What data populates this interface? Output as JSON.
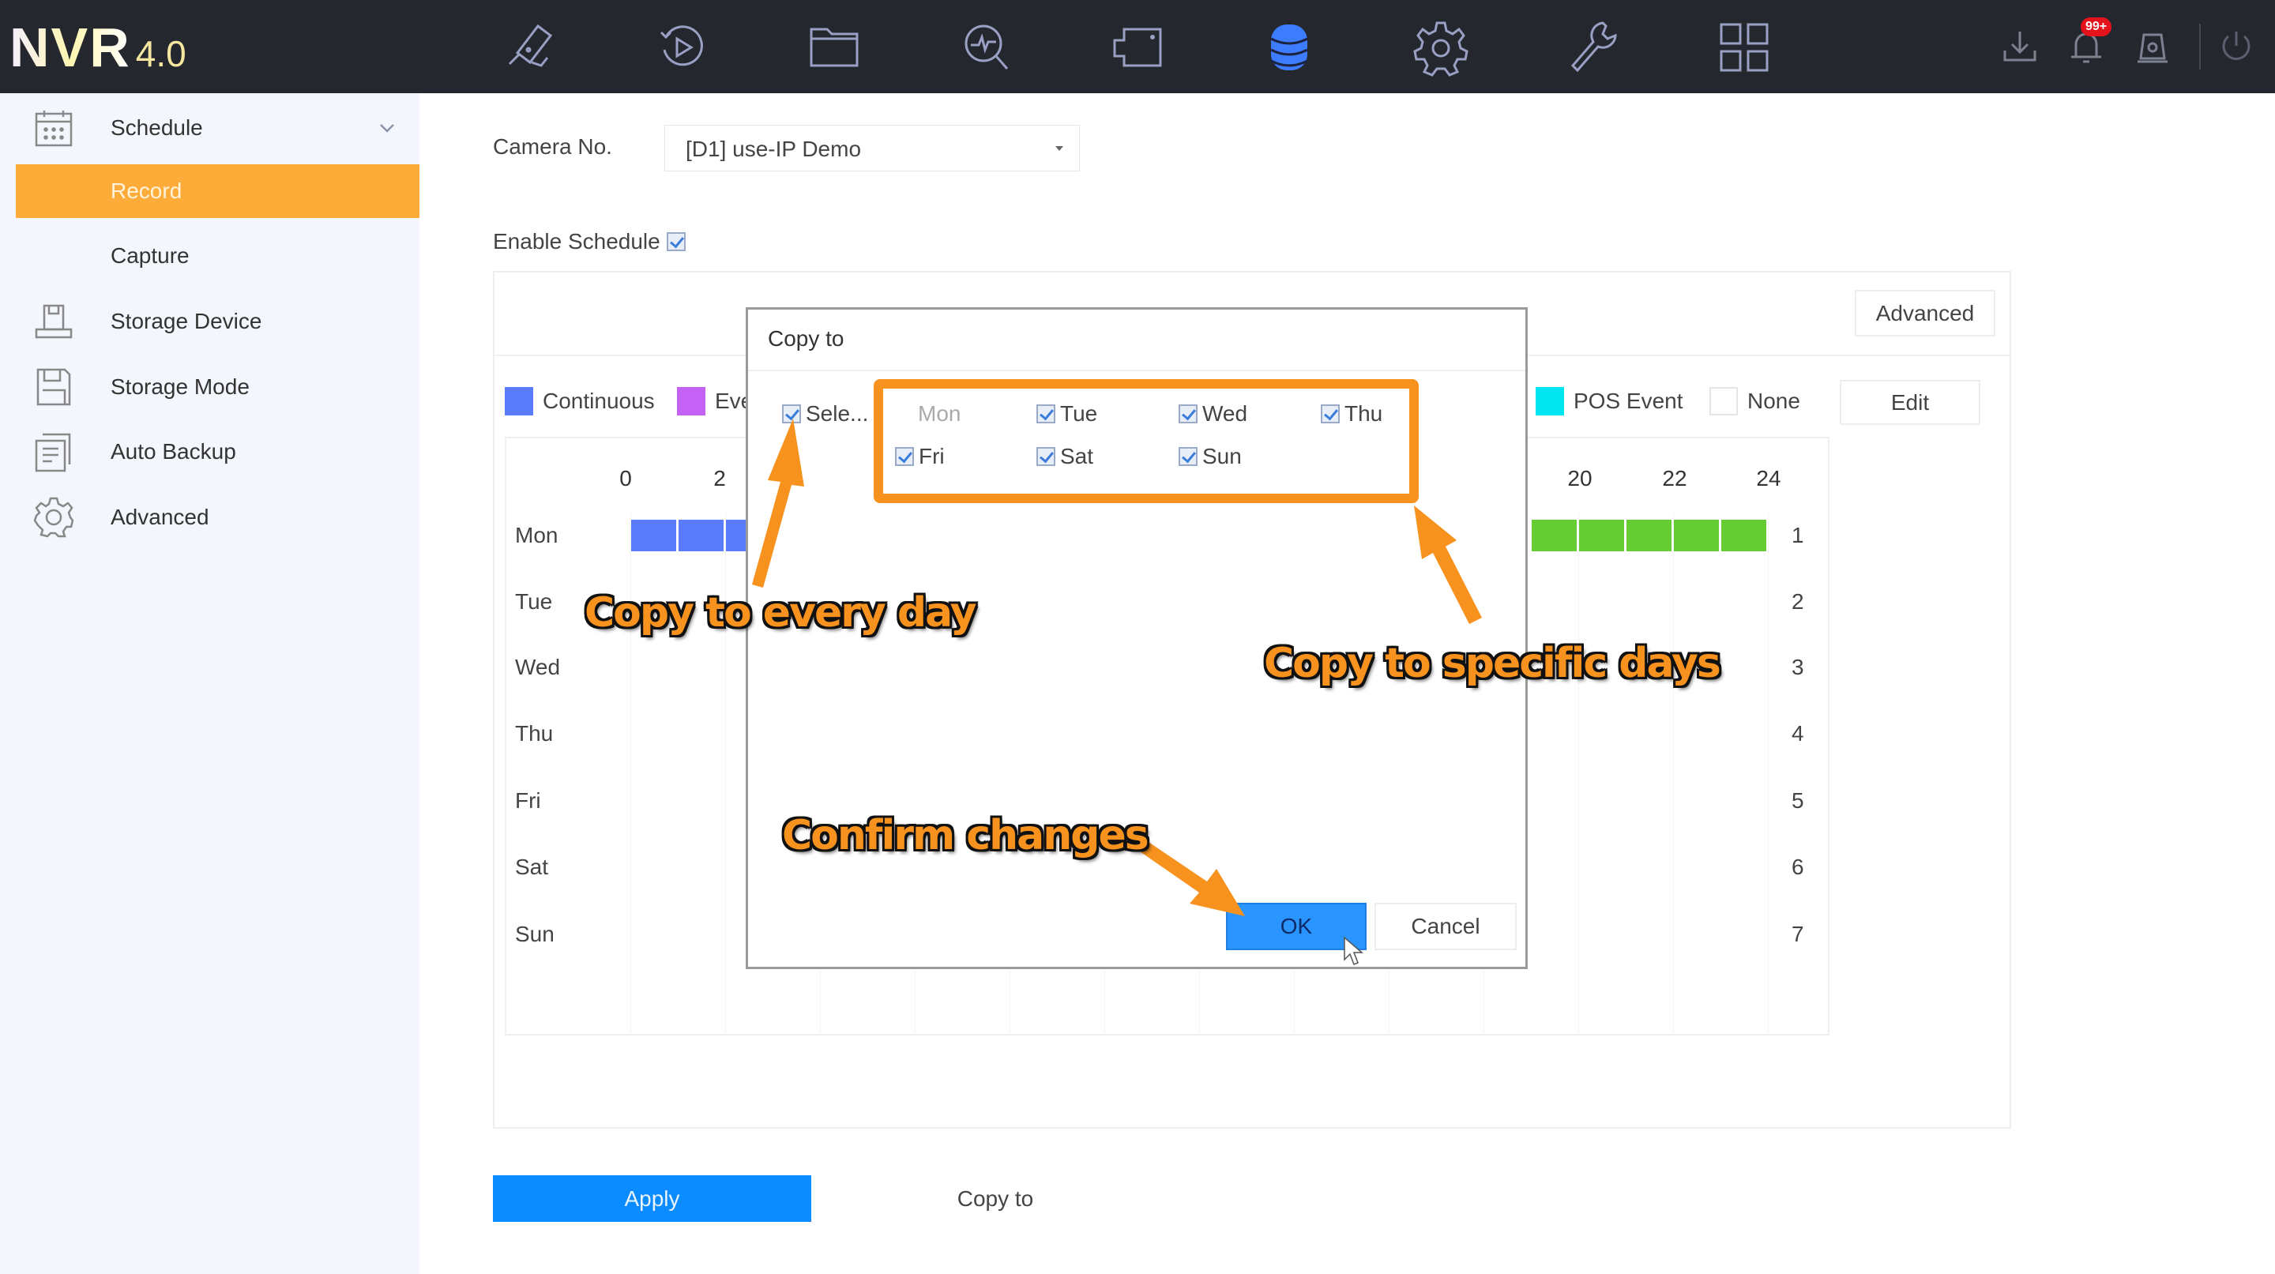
{
  "app": {
    "logo": "NVR",
    "version": "4.0"
  },
  "topnav": {
    "items": [
      {
        "name": "live-view",
        "icon": "camera-icon"
      },
      {
        "name": "playback",
        "icon": "playback-icon"
      },
      {
        "name": "file-management",
        "icon": "folder-icon"
      },
      {
        "name": "smart-analysis",
        "icon": "search-analysis-icon"
      },
      {
        "name": "camera",
        "icon": "video-camera-icon"
      },
      {
        "name": "storage",
        "icon": "database-icon",
        "active": true
      },
      {
        "name": "configuration",
        "icon": "gear-icon"
      },
      {
        "name": "maintenance",
        "icon": "wrench-icon"
      },
      {
        "name": "layout",
        "icon": "grid-icon"
      }
    ],
    "right": {
      "download_icon": "download-icon",
      "alarm_icon": "bell-icon",
      "alarm_badge": "99+",
      "alert_icon": "siren-icon",
      "power_icon": "power-icon"
    },
    "active_color": "#3d7bff"
  },
  "sidebar": {
    "items": [
      {
        "label": "Schedule",
        "icon": "calendar-icon",
        "expanded": true
      },
      {
        "label": "Record",
        "active": true
      },
      {
        "label": "Capture"
      },
      {
        "label": "Storage Device",
        "icon": "storage-device-icon"
      },
      {
        "label": "Storage Mode",
        "icon": "floppy-icon"
      },
      {
        "label": "Auto Backup",
        "icon": "backup-icon"
      },
      {
        "label": "Advanced",
        "icon": "settings-icon"
      }
    ],
    "active_color": "#fdac3a"
  },
  "main": {
    "camera_label": "Camera No.",
    "camera_value": "[D1] use-IP Demo",
    "enable_schedule_label": "Enable Schedule",
    "enable_schedule_checked": true,
    "advanced_button": "Advanced",
    "edit_button": "Edit",
    "legend": [
      {
        "label": "Continuous",
        "color": "#5b7cfa"
      },
      {
        "label": "Eve",
        "color": "#c462f5"
      },
      {
        "label": "POS Event",
        "color": "#00e5f0"
      },
      {
        "label": "None",
        "color": "#ffffff"
      }
    ],
    "hour_labels_visible": [
      "0",
      "2",
      "20",
      "22",
      "24"
    ],
    "days": [
      "Mon",
      "Tue",
      "Wed",
      "Thu",
      "Fri",
      "Sat",
      "Sun"
    ],
    "row_numbers": [
      "1",
      "2",
      "3",
      "4",
      "5",
      "6",
      "7"
    ],
    "schedule": {
      "Mon": [
        {
          "type": "Continuous",
          "start": 0,
          "end": 3,
          "color": "#5b7cfa"
        },
        {
          "type": "Motion",
          "start": 19,
          "end": 24,
          "color": "#66cc33"
        }
      ]
    },
    "apply_button": "Apply",
    "copy_to_button": "Copy to"
  },
  "dialog": {
    "title": "Copy to",
    "select_all_label": "Sele...",
    "select_all_checked": true,
    "days": [
      {
        "label": "Mon",
        "checked": false,
        "disabled": true
      },
      {
        "label": "Tue",
        "checked": true
      },
      {
        "label": "Wed",
        "checked": true
      },
      {
        "label": "Thu",
        "checked": true
      },
      {
        "label": "Fri",
        "checked": true
      },
      {
        "label": "Sat",
        "checked": true
      },
      {
        "label": "Sun",
        "checked": true
      }
    ],
    "ok_button": "OK",
    "cancel_button": "Cancel"
  },
  "annotations": {
    "every_day": "Copy to every day",
    "specific_days": "Copy to specific days",
    "confirm": "Confirm changes",
    "color": "#f7921e"
  }
}
